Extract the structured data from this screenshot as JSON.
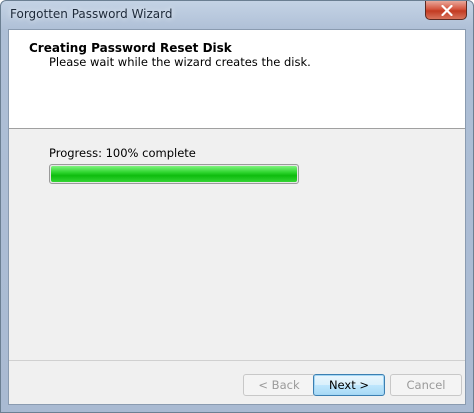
{
  "window": {
    "title": "Forgotten Password Wizard"
  },
  "header": {
    "title": "Creating Password Reset Disk",
    "subtitle": "Please wait while the wizard creates the disk."
  },
  "progress": {
    "label": "Progress: 100% complete",
    "percent": 100,
    "color": "#1ec81e"
  },
  "buttons": {
    "back_label": "< Back",
    "next_label": "Next >",
    "cancel_label": "Cancel"
  },
  "icons": {
    "close": "close-icon"
  }
}
